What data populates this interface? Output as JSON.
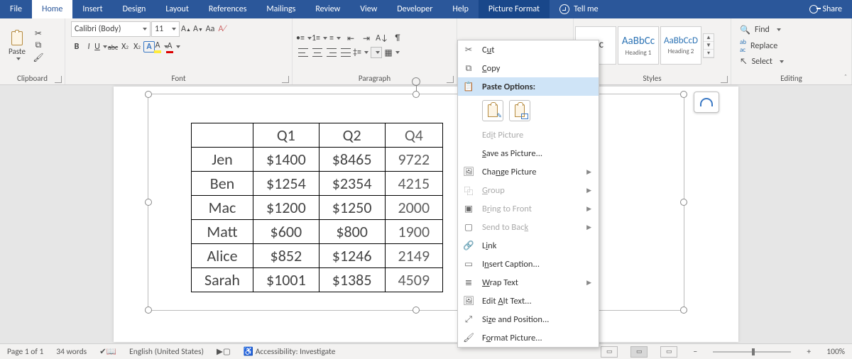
{
  "tabs": {
    "file": "File",
    "home": "Home",
    "insert": "Insert",
    "design": "Design",
    "layout": "Layout",
    "references": "References",
    "mailings": "Mailings",
    "review": "Review",
    "view": "View",
    "developer": "Developer",
    "help": "Help",
    "picture_format": "Picture Format",
    "tell_me": "Tell me",
    "share": "Share"
  },
  "ribbon": {
    "clipboard": {
      "paste": "Paste",
      "label": "Clipboard"
    },
    "font": {
      "name": "Calibri (Body)",
      "size": "11",
      "label": "Font",
      "bold": "B",
      "italic": "I",
      "underline": "U",
      "strike": "abc"
    },
    "paragraph": {
      "label": "Paragraph"
    },
    "styles": {
      "label": "Styles",
      "tiles": [
        {
          "prev": "cDc",
          "name": ""
        },
        {
          "prev": "AaBbCc",
          "name": "Heading 1"
        },
        {
          "prev": "AaBbCcD",
          "name": "Heading 2"
        }
      ]
    },
    "editing": {
      "find": "Find",
      "replace": "Replace",
      "select": "Select",
      "label": "Editing"
    }
  },
  "context_menu": {
    "cut": "Cut",
    "copy": "Copy",
    "paste_options": "Paste Options:",
    "edit_picture": "Edit Picture",
    "save_as_picture": "Save as Picture...",
    "change_picture": "Change Picture",
    "group": "Group",
    "bring_to_front": "Bring to Front",
    "send_to_back": "Send to Back",
    "link": "Link",
    "insert_caption": "Insert Caption...",
    "wrap_text": "Wrap Text",
    "edit_alt_text": "Edit Alt Text...",
    "size_and_position": "Size and Position...",
    "format_picture": "Format Picture..."
  },
  "table": {
    "headers": [
      "",
      "Q1",
      "Q2",
      "Q4"
    ],
    "rows": [
      [
        "Jen",
        "$1400",
        "$8465",
        "9722"
      ],
      [
        "Ben",
        "$1254",
        "$2354",
        "4215"
      ],
      [
        "Mac",
        "$1200",
        "$1250",
        "2000"
      ],
      [
        "Matt",
        "$600",
        "$800",
        "1900"
      ],
      [
        "Alice",
        "$852",
        "$1246",
        "2149"
      ],
      [
        "Sarah",
        "$1001",
        "$1385",
        "4509"
      ]
    ]
  },
  "status": {
    "page": "Page 1 of 1",
    "words": "34 words",
    "language": "English (United States)",
    "accessibility": "Accessibility: Investigate",
    "zoom": "100%"
  }
}
